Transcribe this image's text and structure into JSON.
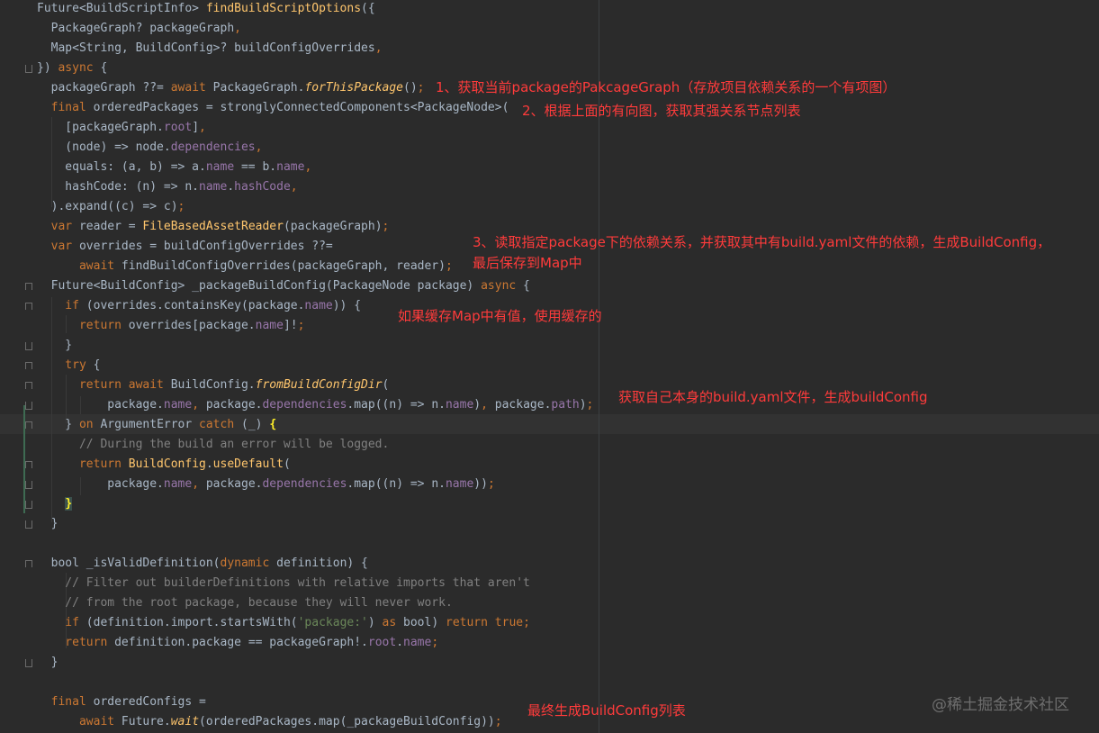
{
  "watermark": "@稀土掘金技术社区",
  "annotations": [
    "1、获取当前package的PakcageGraph（存放项目依赖关系的一个有项图）",
    "2、根据上面的有向图，获取其强关系节点列表",
    "3、读取指定package下的依赖关系，并获取其中有build.yaml文件的依赖，生成BuildConfig，",
    "最后保存到Map中",
    "如果缓存Map中有值，使用缓存的",
    "获取自己本身的build.yaml文件，生成buildConfig",
    "最终生成BuildConfig列表"
  ],
  "code": {
    "lines": [
      [
        [
          "plain",
          "Future<BuildScriptInfo> "
        ],
        [
          "fn",
          "findBuildScriptOptions"
        ],
        [
          "plain",
          "({"
        ]
      ],
      [
        [
          "plain",
          "  PackageGraph? packageGraph"
        ],
        [
          "kw",
          ","
        ]
      ],
      [
        [
          "plain",
          "  Map<String, BuildConfig>? buildConfigOverrides"
        ],
        [
          "kw",
          ","
        ]
      ],
      [
        [
          "plain",
          "}) "
        ],
        [
          "kw",
          "async"
        ],
        [
          "plain",
          " {"
        ]
      ],
      [
        [
          "plain",
          "  packageGraph ??= "
        ],
        [
          "kw",
          "await"
        ],
        [
          "plain",
          " PackageGraph."
        ],
        [
          "fni",
          "forThisPackage"
        ],
        [
          "plain",
          "()"
        ],
        [
          "kw",
          ";"
        ]
      ],
      [
        [
          "kw",
          "  final"
        ],
        [
          "plain",
          " orderedPackages = stronglyConnectedComponents<PackageNode>("
        ]
      ],
      [
        [
          "plain",
          "    [packageGraph."
        ],
        [
          "field",
          "root"
        ],
        [
          "plain",
          "]"
        ],
        [
          "kw",
          ","
        ]
      ],
      [
        [
          "plain",
          "    (node) => node."
        ],
        [
          "field",
          "dependencies"
        ],
        [
          "kw",
          ","
        ]
      ],
      [
        [
          "plain",
          "    equals: (a, b) => a."
        ],
        [
          "field",
          "name"
        ],
        [
          "plain",
          " == b."
        ],
        [
          "field",
          "name"
        ],
        [
          "kw",
          ","
        ]
      ],
      [
        [
          "plain",
          "    hashCode: (n) => n."
        ],
        [
          "field",
          "name"
        ],
        [
          "plain",
          "."
        ],
        [
          "field",
          "hashCode"
        ],
        [
          "kw",
          ","
        ]
      ],
      [
        [
          "plain",
          "  ).expand((c) => c)"
        ],
        [
          "kw",
          ";"
        ]
      ],
      [
        [
          "kw",
          "  var"
        ],
        [
          "plain",
          " reader = "
        ],
        [
          "fn",
          "FileBasedAssetReader"
        ],
        [
          "plain",
          "(packageGraph)"
        ],
        [
          "kw",
          ";"
        ]
      ],
      [
        [
          "kw",
          "  var"
        ],
        [
          "plain",
          " overrides = buildConfigOverrides ??="
        ]
      ],
      [
        [
          "kw",
          "      await"
        ],
        [
          "plain",
          " findBuildConfigOverrides(packageGraph, reader)"
        ],
        [
          "kw",
          ";"
        ]
      ],
      [
        [
          "plain",
          "  Future<BuildConfig> _packageBuildConfig(PackageNode package) "
        ],
        [
          "kw",
          "async"
        ],
        [
          "plain",
          " {"
        ]
      ],
      [
        [
          "kw",
          "    if"
        ],
        [
          "plain",
          " (overrides.containsKey(package."
        ],
        [
          "field",
          "name"
        ],
        [
          "plain",
          ")) {"
        ]
      ],
      [
        [
          "kw",
          "      return"
        ],
        [
          "plain",
          " overrides[package."
        ],
        [
          "field",
          "name"
        ],
        [
          "plain",
          "]!"
        ],
        [
          "kw",
          ";"
        ]
      ],
      [
        [
          "plain",
          "    }"
        ]
      ],
      [
        [
          "kw",
          "    try"
        ],
        [
          "plain",
          " {"
        ]
      ],
      [
        [
          "kw",
          "      return await"
        ],
        [
          "plain",
          " BuildConfig."
        ],
        [
          "fni",
          "fromBuildConfigDir"
        ],
        [
          "plain",
          "("
        ]
      ],
      [
        [
          "plain",
          "          package."
        ],
        [
          "field",
          "name"
        ],
        [
          "kw",
          ","
        ],
        [
          "plain",
          " package."
        ],
        [
          "field",
          "dependencies"
        ],
        [
          "plain",
          ".map((n) => n."
        ],
        [
          "field",
          "name"
        ],
        [
          "plain",
          ")"
        ],
        [
          "kw",
          ","
        ],
        [
          "plain",
          " package."
        ],
        [
          "field",
          "path"
        ],
        [
          "plain",
          ")"
        ],
        [
          "kw",
          ";"
        ]
      ],
      [
        [
          "plain",
          "    } "
        ],
        [
          "kw",
          "on"
        ],
        [
          "plain",
          " ArgumentError "
        ],
        [
          "kw",
          "catch"
        ],
        [
          "plain",
          " (_) "
        ],
        [
          "brace-hl",
          "{"
        ]
      ],
      [
        [
          "cmt",
          "      // During the build an error will be logged."
        ]
      ],
      [
        [
          "kw",
          "      return"
        ],
        [
          "plain",
          " "
        ],
        [
          "fn",
          "BuildConfig"
        ],
        [
          "plain",
          "."
        ],
        [
          "fn",
          "useDefault"
        ],
        [
          "plain",
          "("
        ]
      ],
      [
        [
          "plain",
          "          package."
        ],
        [
          "field",
          "name"
        ],
        [
          "kw",
          ","
        ],
        [
          "plain",
          " package."
        ],
        [
          "field",
          "dependencies"
        ],
        [
          "plain",
          ".map((n) => n."
        ],
        [
          "field",
          "name"
        ],
        [
          "plain",
          "))"
        ],
        [
          "kw",
          ";"
        ]
      ],
      [
        [
          "plain",
          "    "
        ],
        [
          "brace-hl2",
          "}"
        ]
      ],
      [
        [
          "plain",
          "  }"
        ]
      ],
      [
        [
          "plain",
          ""
        ]
      ],
      [
        [
          "plain",
          "  bool _isValidDefinition("
        ],
        [
          "kw",
          "dynamic"
        ],
        [
          "plain",
          " definition) {"
        ]
      ],
      [
        [
          "cmt",
          "    // Filter out builderDefinitions with relative imports that aren't"
        ]
      ],
      [
        [
          "cmt",
          "    // from the root package, because they will never work."
        ]
      ],
      [
        [
          "kw",
          "    if"
        ],
        [
          "plain",
          " (definition.import.startsWith("
        ],
        [
          "str",
          "'package:'"
        ],
        [
          "plain",
          ") "
        ],
        [
          "kw",
          "as"
        ],
        [
          "plain",
          " bool) "
        ],
        [
          "kw",
          "return true"
        ],
        [
          "kw",
          ";"
        ]
      ],
      [
        [
          "kw",
          "    return"
        ],
        [
          "plain",
          " definition.package == packageGraph!."
        ],
        [
          "field",
          "root"
        ],
        [
          "plain",
          "."
        ],
        [
          "field",
          "name"
        ],
        [
          "kw",
          ";"
        ]
      ],
      [
        [
          "plain",
          "  }"
        ]
      ],
      [
        [
          "plain",
          ""
        ]
      ],
      [
        [
          "kw",
          "  final"
        ],
        [
          "plain",
          " orderedConfigs ="
        ]
      ],
      [
        [
          "kw",
          "      await"
        ],
        [
          "plain",
          " Future."
        ],
        [
          "fni",
          "wait"
        ],
        [
          "plain",
          "(orderedPackages.map(_packageBuildConfig))"
        ],
        [
          "kw",
          ";"
        ]
      ]
    ]
  }
}
